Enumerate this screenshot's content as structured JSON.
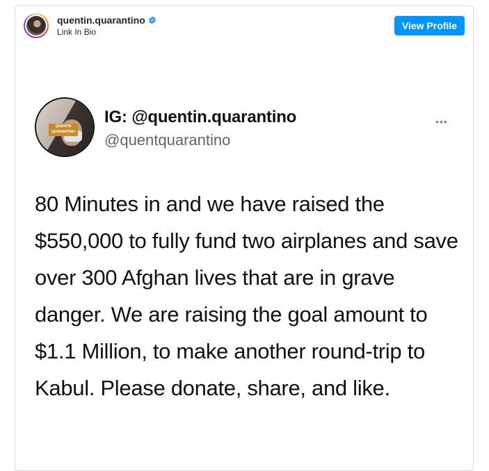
{
  "post": {
    "username": "quentin.quarantino",
    "subline": "Link In Bio",
    "view_profile_label": "View Profile",
    "colors": {
      "accent": "#0095f6",
      "verified": "#3897f0"
    }
  },
  "tweet": {
    "display_name": "IG: @quentin.quarantino",
    "handle": "@quentquarantino",
    "avatar_badge": "QUENTIN QUARANTINO",
    "more_icon": "•••",
    "text": "80 Minutes in and we have raised the $550,000 to fully fund two airplanes and save over 300 Afghan lives that are in grave danger. We are raising the goal amount to $1.1 Million, to make another round-trip to Kabul. Please donate, share, and like."
  }
}
